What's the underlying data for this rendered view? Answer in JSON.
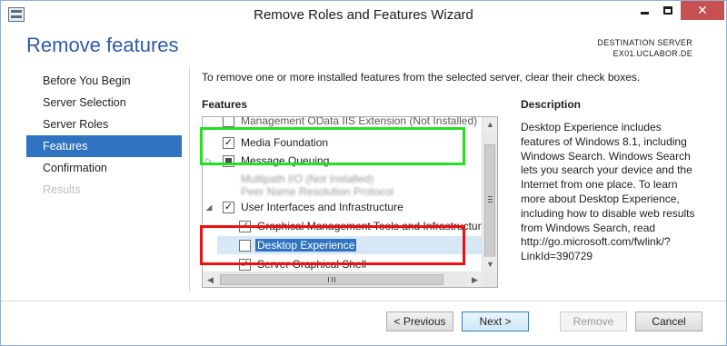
{
  "window": {
    "title": "Remove Roles and Features Wizard",
    "minimize_icon": "minimize-icon",
    "maximize_icon": "maximize-icon",
    "close_glyph": "✕"
  },
  "header": {
    "heading": "Remove features",
    "destination_label": "DESTINATION SERVER",
    "destination_server": "EX01.UCLABOR.DE"
  },
  "nav": {
    "items": [
      {
        "label": "Before You Begin",
        "state": "normal"
      },
      {
        "label": "Server Selection",
        "state": "normal"
      },
      {
        "label": "Server Roles",
        "state": "normal"
      },
      {
        "label": "Features",
        "state": "active"
      },
      {
        "label": "Confirmation",
        "state": "normal"
      },
      {
        "label": "Results",
        "state": "disabled"
      }
    ]
  },
  "main": {
    "intro": "To remove one or more installed features from the selected server, clear their check boxes.",
    "features_label": "Features",
    "tree": [
      {
        "label": "Management OData IIS Extension (Not Installed)",
        "checked": false,
        "expander": "",
        "note": "partially scrolled out of view"
      },
      {
        "label": "Media Foundation",
        "checked": true,
        "expander": ""
      },
      {
        "label": "Message Queuing",
        "checked": "partial",
        "expander": "▷"
      },
      {
        "label": "Multipath I/O (Not Installed)",
        "checked": false,
        "expander": "",
        "note": "blurred"
      },
      {
        "label": "Peer Name Resolution Protocol",
        "checked": false,
        "expander": "",
        "note": "blurred"
      },
      {
        "label": "User Interfaces and Infrastructure",
        "checked": true,
        "expander": "◢"
      },
      {
        "label": "Graphical Management Tools and Infrastructure",
        "checked": true,
        "expander": ""
      },
      {
        "label": "Desktop Experience",
        "checked": false,
        "expander": "",
        "selected": true
      },
      {
        "label": "Server Graphical Shell",
        "checked": true,
        "expander": ""
      }
    ],
    "scroll_up_glyph": "▲",
    "scroll_down_glyph": "▼",
    "scroll_left_glyph": "◀",
    "scroll_right_glyph": "▶"
  },
  "description": {
    "heading": "Description",
    "text": "Desktop Experience includes features of Windows 8.1, including Windows Search. Windows Search lets you search your device and the Internet from one place. To learn more about Desktop Experience, including how to disable web results from Windows Search, read http://go.microsoft.com/fwlink/?LinkId=390729"
  },
  "annotations": {
    "green_color": "#22e022",
    "red_color": "#ee1010"
  },
  "footer": {
    "previous_label": "< Previous",
    "next_label": "Next >",
    "remove_label": "Remove",
    "cancel_label": "Cancel"
  }
}
